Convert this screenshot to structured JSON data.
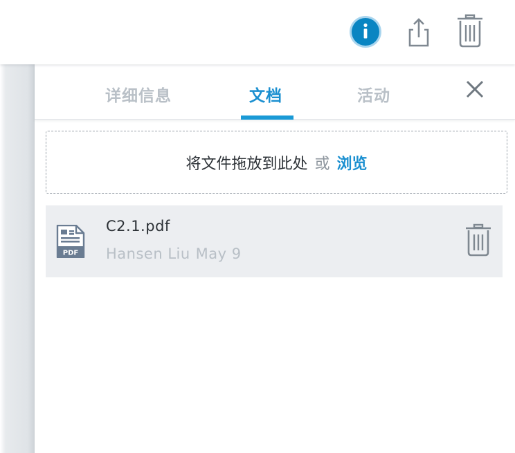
{
  "toolbar": {
    "info_icon": "info-icon",
    "share_icon": "share-icon",
    "trash_icon": "trash-icon",
    "info_color": "#0a85c2"
  },
  "tabs": [
    {
      "label": "详细信息",
      "active": false
    },
    {
      "label": "文档",
      "active": true
    },
    {
      "label": "活动",
      "active": false
    }
  ],
  "dropzone": {
    "text": "将文件拖放到此处",
    "or": "或",
    "browse": "浏览"
  },
  "files": [
    {
      "name": "C2.1.pdf",
      "author": "Hansen Liu",
      "date": "May 9",
      "type_label": "PDF"
    }
  ],
  "colors": {
    "accent": "#1a8fd0",
    "inactive_tab": "#b9c0c7",
    "row_bg": "#eceef1",
    "icon_gray": "#7f8891"
  }
}
